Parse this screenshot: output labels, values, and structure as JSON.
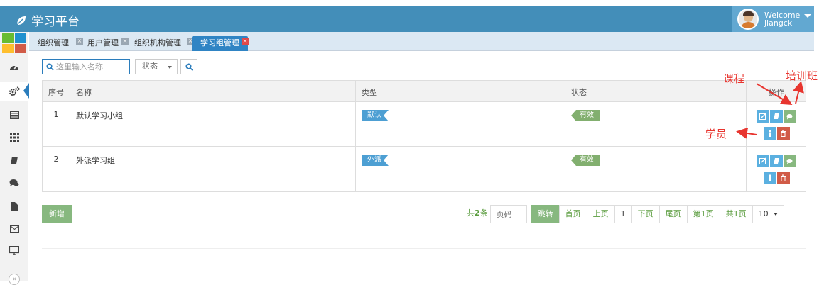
{
  "app": {
    "title": "学习平台"
  },
  "user": {
    "welcome": "Welcome",
    "name": "jiangck"
  },
  "tabs": [
    {
      "label": "组织管理",
      "active": false
    },
    {
      "label": "用户管理",
      "active": false
    },
    {
      "label": "组织机构管理",
      "active": false
    },
    {
      "label": "学习组管理",
      "active": true
    }
  ],
  "toolbar": {
    "search_placeholder": "这里输入名称",
    "status_label": "状态"
  },
  "table": {
    "headers": [
      "序号",
      "名称",
      "类型",
      "状态",
      "操作"
    ],
    "rows": [
      {
        "no": "1",
        "name": "默认学习小组",
        "type": "默认",
        "status": "有效"
      },
      {
        "no": "2",
        "name": "外派学习组",
        "type": "外派",
        "status": "有效"
      }
    ]
  },
  "footer": {
    "add_label": "新增",
    "total_prefix": "共",
    "total_count": "2",
    "total_suffix": "条",
    "page_placeholder": "页码",
    "jump_label": "跳转",
    "first_label": "首页",
    "prev_label": "上页",
    "current_page": "1",
    "next_label": "下页",
    "last_label": "尾页",
    "page_info": "第1页",
    "pages_info": "共1页",
    "page_size": "10"
  },
  "annotations": {
    "course": "课程",
    "training": "培训班",
    "students": "学员"
  },
  "colors": {
    "header": "#438eb9",
    "tab_active": "#2f84c4",
    "success": "#87b87f",
    "info": "#5bb0e0",
    "danger": "#d15b47",
    "annotation": "#e8352f"
  }
}
